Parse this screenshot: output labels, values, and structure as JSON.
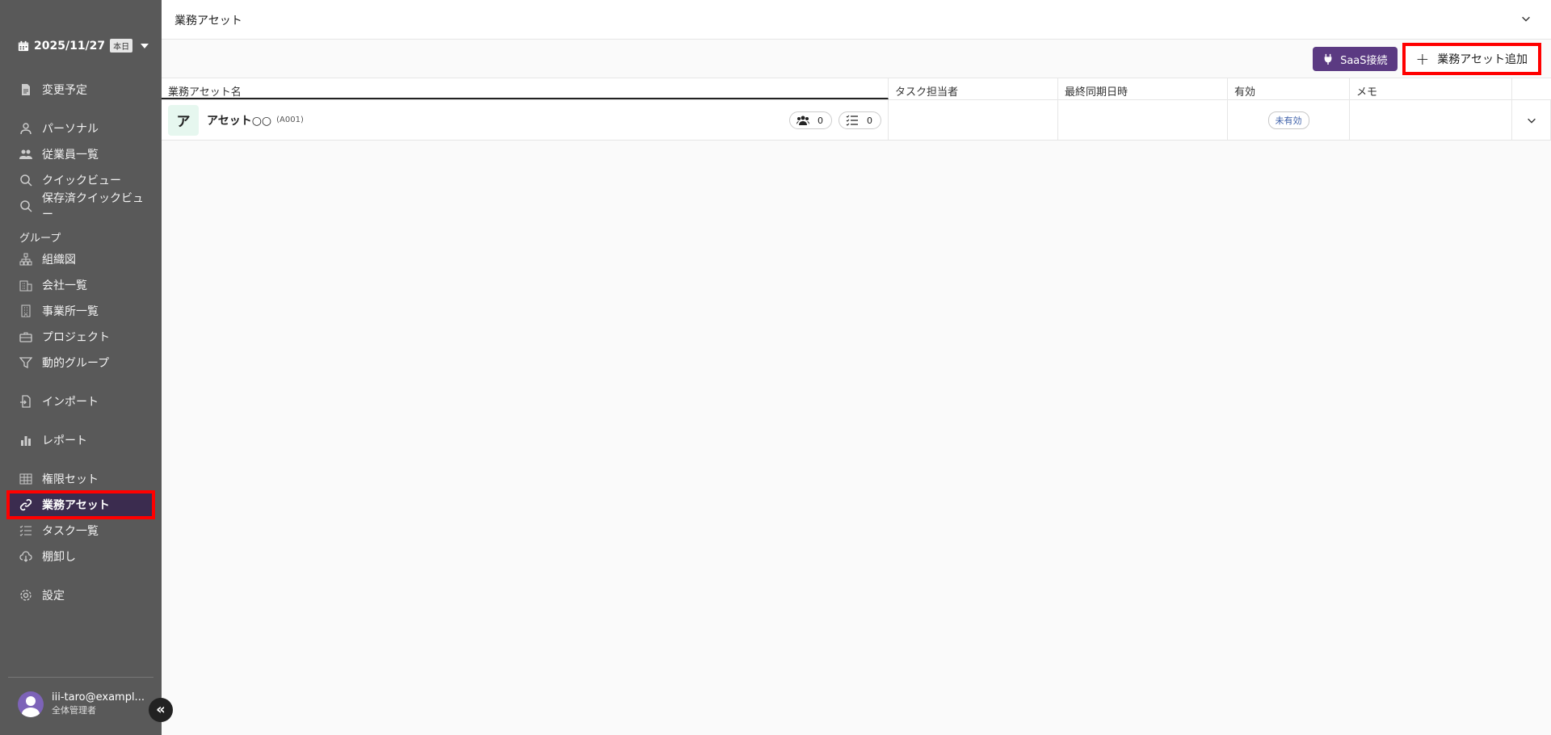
{
  "sidebar": {
    "date": "2025/11/27",
    "today_label": "本日",
    "items": [
      {
        "key": "changes",
        "label": "変更予定"
      },
      {
        "key": "personal",
        "label": "パーソナル"
      },
      {
        "key": "employees",
        "label": "従業員一覧"
      },
      {
        "key": "quickview",
        "label": "クイックビュー"
      },
      {
        "key": "saved_quickview",
        "label": "保存済クイックビュー"
      },
      {
        "key": "org",
        "label": "組織図"
      },
      {
        "key": "companies",
        "label": "会社一覧"
      },
      {
        "key": "offices",
        "label": "事業所一覧"
      },
      {
        "key": "projects",
        "label": "プロジェクト"
      },
      {
        "key": "dynamic_groups",
        "label": "動的グループ"
      },
      {
        "key": "import",
        "label": "インポート"
      },
      {
        "key": "report",
        "label": "レポート"
      },
      {
        "key": "permission_sets",
        "label": "権限セット"
      },
      {
        "key": "assets",
        "label": "業務アセット"
      },
      {
        "key": "tasks",
        "label": "タスク一覧"
      },
      {
        "key": "inventory",
        "label": "棚卸し"
      },
      {
        "key": "settings",
        "label": "設定"
      }
    ],
    "group_label": "グループ",
    "user": {
      "email": "iii-taro@exampl...",
      "role": "全体管理者"
    },
    "collapse_label": "«"
  },
  "header": {
    "title": "業務アセット"
  },
  "actions": {
    "saas_label": "SaaS接続",
    "add_label": "業務アセット追加"
  },
  "table": {
    "columns": [
      "業務アセット名",
      "タスク担当者",
      "最終同期日時",
      "有効",
      "メモ"
    ],
    "rows": [
      {
        "icon_char": "ア",
        "name": "アセット○○",
        "code": "(A001)",
        "members_count": "0",
        "tasks_count": "0",
        "task_owner": "",
        "last_sync": "",
        "status": "未有効",
        "memo": ""
      }
    ]
  },
  "colors": {
    "sidebar_bg": "#595959",
    "active_bg": "#3b2c4f",
    "accent": "#5b3a82",
    "highlight": "#ff0000"
  }
}
